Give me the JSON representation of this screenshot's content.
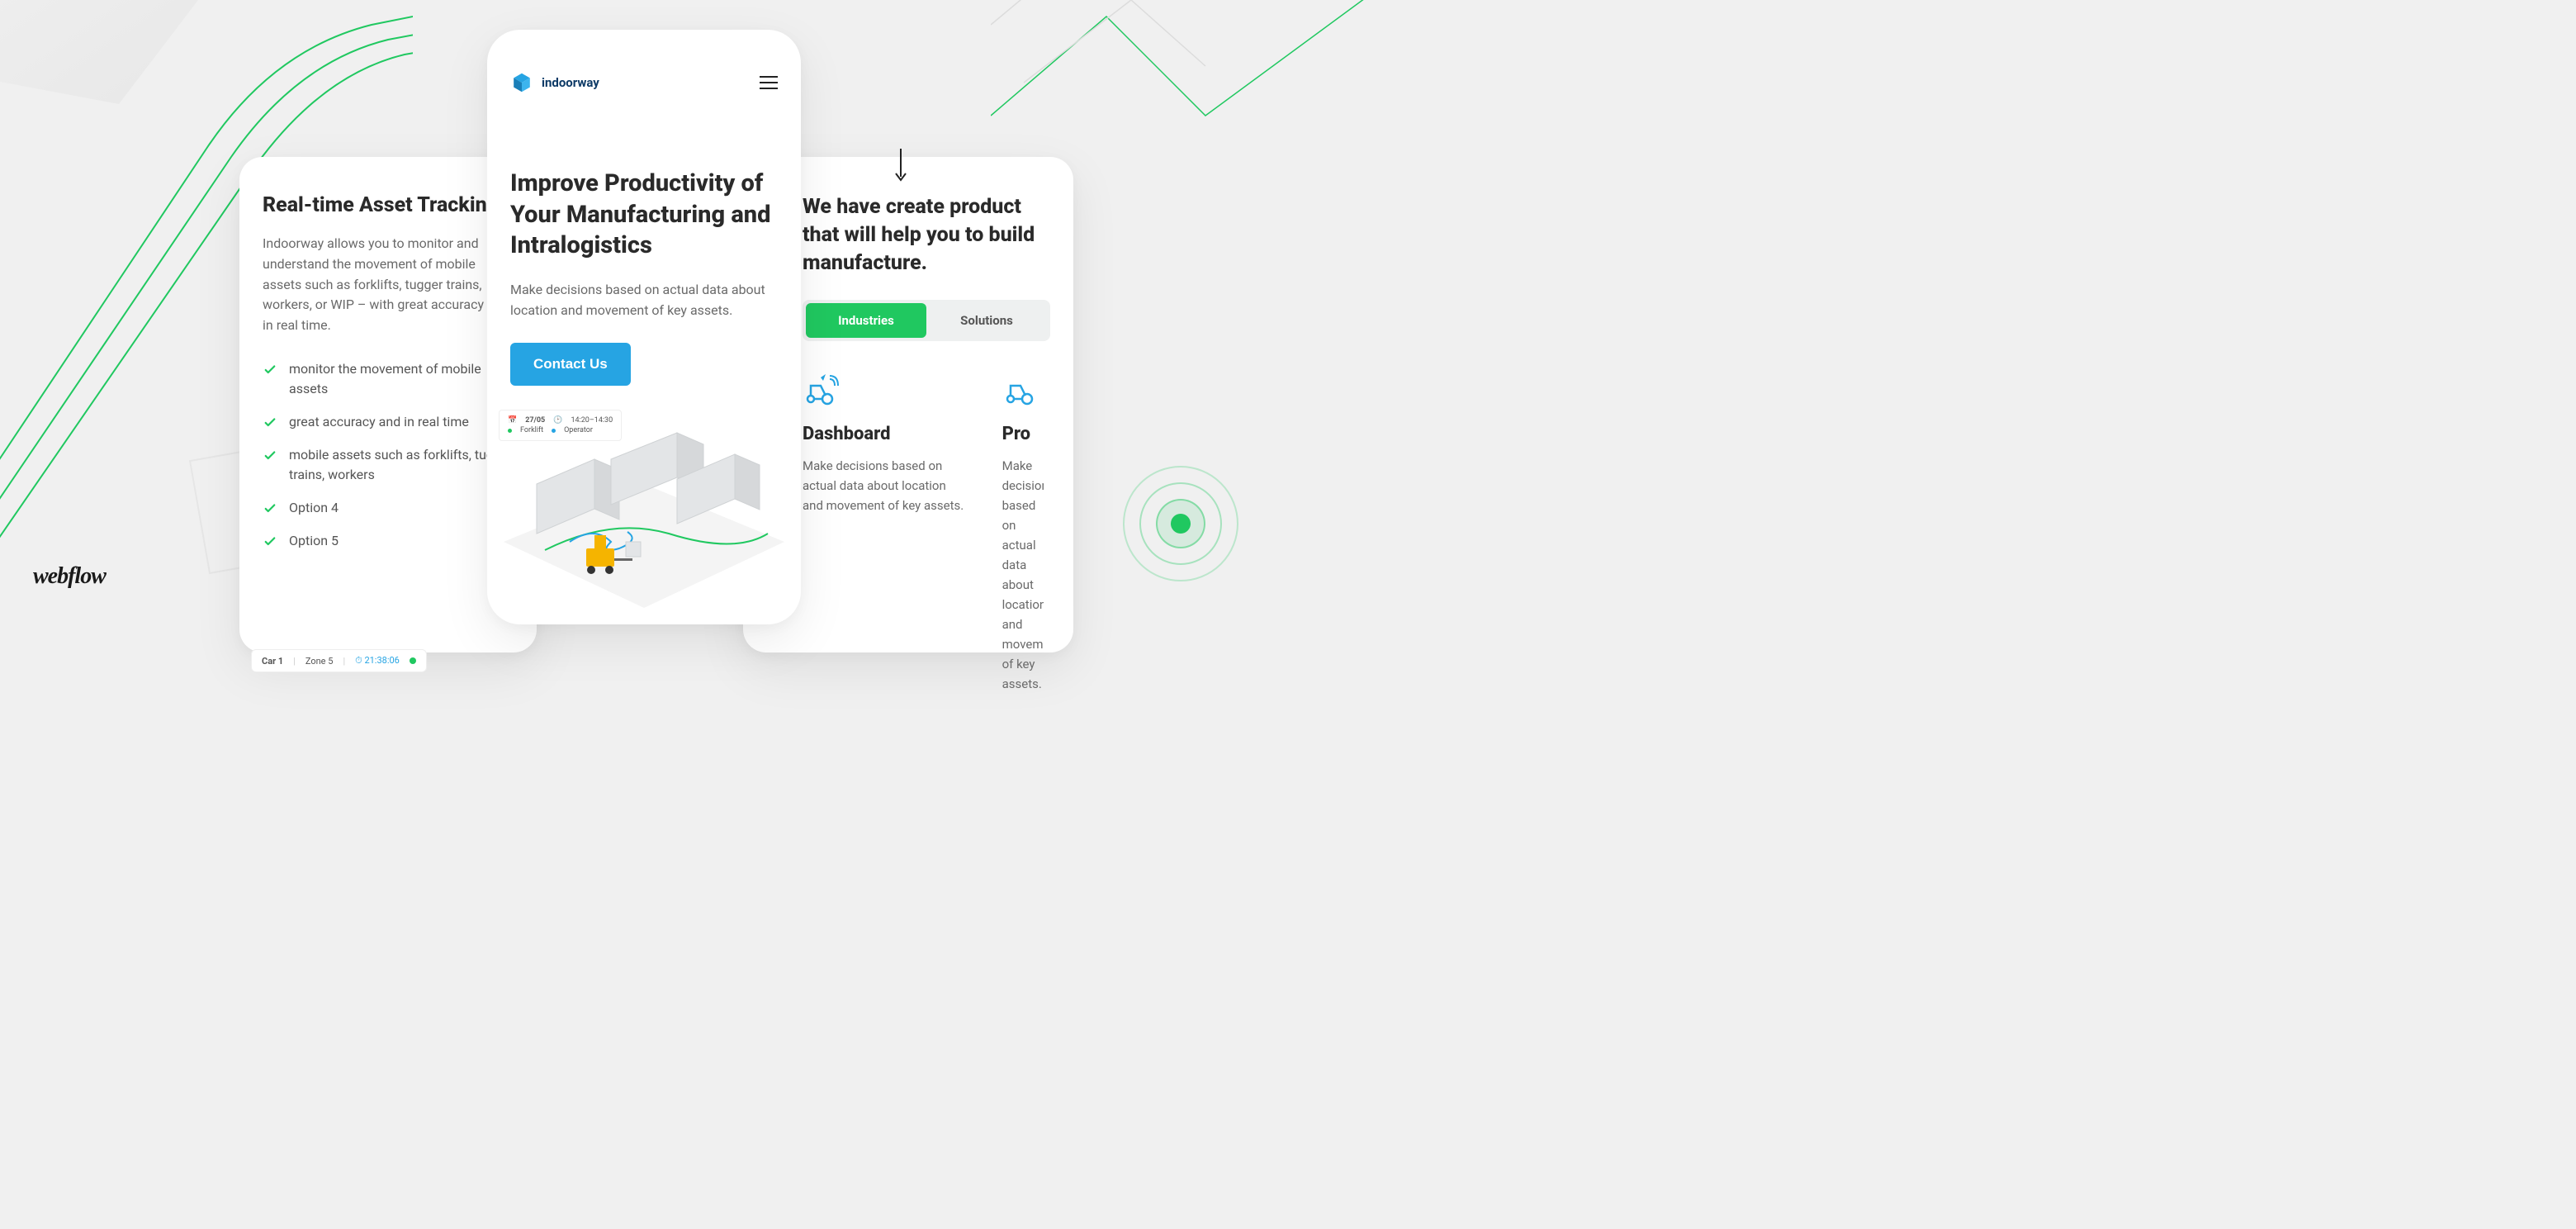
{
  "brand": {
    "name": "indoorway"
  },
  "webflow_label": "webflow",
  "left": {
    "title": "Real-time Asset Tracking",
    "desc": "Indoorway allows you to monitor and understand the movement of mobile assets such as forklifts, tugger trains, workers, or WIP – with great accuracy and in real time.",
    "bullets": [
      "monitor the movement of mobile assets",
      "great accuracy and in real time",
      "mobile assets such as forklifts, tugger trains, workers",
      "Option 4",
      "Option 5"
    ],
    "status": {
      "car": "Car 1",
      "zone": "Zone 5",
      "time": "21:38:06"
    }
  },
  "center": {
    "title": "Improve Productivity of Your Manufacturing and Intralogistics",
    "subtitle": "Make decisions based on actual data about location and movement of key assets.",
    "cta": "Contact Us",
    "legend": {
      "date": "27/05",
      "time": "14:20–14:30",
      "forklift": "Forklift",
      "operator": "Operator"
    }
  },
  "right": {
    "title": "We have create product that will help you to build manufacture.",
    "tabs": {
      "a": "Industries",
      "b": "Solutions"
    },
    "tiles": [
      {
        "title": "Dashboard",
        "desc": "Make decisions based on actual data about location and movement of key assets."
      },
      {
        "title": "Pro",
        "desc": "Make decisions based on actual data about location and movement of key assets."
      }
    ]
  }
}
